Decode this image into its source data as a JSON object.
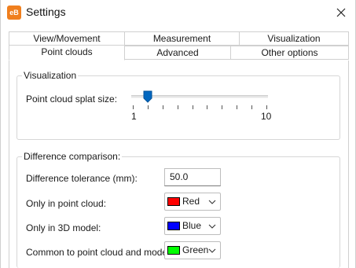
{
  "window": {
    "app_icon_text": "eB",
    "title": "Settings"
  },
  "tabs": {
    "row1": [
      "View/Movement",
      "Measurement",
      "Visualization"
    ],
    "row2": [
      "Point clouds",
      "Advanced",
      "Other options"
    ],
    "active": "Point clouds"
  },
  "visualization": {
    "group_title": "Visualization",
    "splat_label": "Point cloud splat size:",
    "slider_min_label": "1",
    "slider_max_label": "10",
    "slider_min": 1,
    "slider_max": 10,
    "slider_value": 2
  },
  "difference": {
    "group_title": "Difference comparison:",
    "tolerance_label": "Difference tolerance (mm):",
    "tolerance_value": "50.0",
    "only_cloud_label": "Only in point cloud:",
    "only_cloud_color_name": "Red",
    "only_cloud_color": "#ff0000",
    "only_model_label": "Only in 3D model:",
    "only_model_color_name": "Blue",
    "only_model_color": "#0000ff",
    "common_label": "Common to point cloud and model:",
    "common_color_name": "Green",
    "common_color": "#00ff00"
  },
  "colors": {
    "accent": "#0067c0",
    "app_icon": "#f07f1e"
  }
}
